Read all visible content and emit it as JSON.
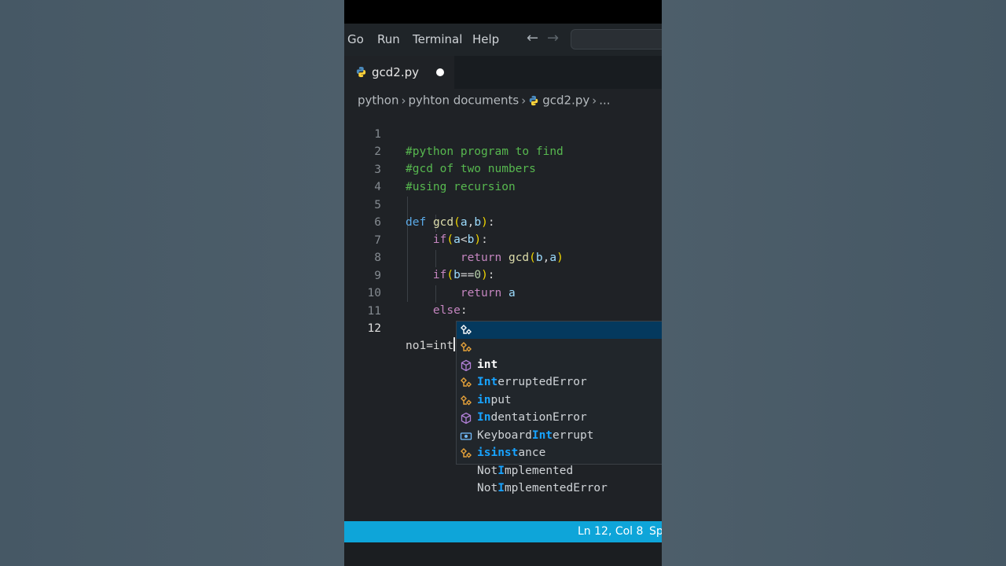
{
  "menu": {
    "items": [
      "Go",
      "Run",
      "Terminal",
      "Help"
    ]
  },
  "tab": {
    "label": "gcd2.py"
  },
  "breadcrumb": {
    "part1": "python",
    "part2": "pyhton documents",
    "part3": "gcd2.py",
    "ellipsis": "..."
  },
  "code": {
    "line_numbers": [
      "1",
      "2",
      "3",
      "4",
      "5",
      "6",
      "7",
      "8",
      "9",
      "10",
      "11",
      "12"
    ],
    "l1": "#python program to find",
    "l2": "#gcd of two numbers",
    "l3": "#using recursion",
    "l12": "no1=int"
  },
  "suggestions": [
    {
      "pre": "",
      "hl1": "int",
      "rest": "",
      "kind": "class"
    },
    {
      "pre": "",
      "hl1": "Int",
      "rest": "erruptedError",
      "kind": "class"
    },
    {
      "pre": "",
      "hl1": "in",
      "rest": "put",
      "kind": "function"
    },
    {
      "pre": "",
      "hl1": "In",
      "rest": "dentationError",
      "kind": "class"
    },
    {
      "pre": "Keyboard",
      "hl1": "Int",
      "rest": "errupt",
      "kind": "class"
    },
    {
      "pre": "",
      "hl1": "isinst",
      "rest": "ance",
      "kind": "function"
    },
    {
      "pre": "Not",
      "hl1": "I",
      "rest": "mplemented",
      "kind": "variable"
    },
    {
      "pre": "Not",
      "hl1": "I",
      "rest": "mplementedError",
      "kind": "class"
    }
  ],
  "status": {
    "position": "Ln 12, Col 8",
    "spaces": "Sp"
  },
  "colors": {
    "statusbar": "#0ea5d9",
    "accent": "#18a3ff",
    "selection": "#04395e"
  }
}
